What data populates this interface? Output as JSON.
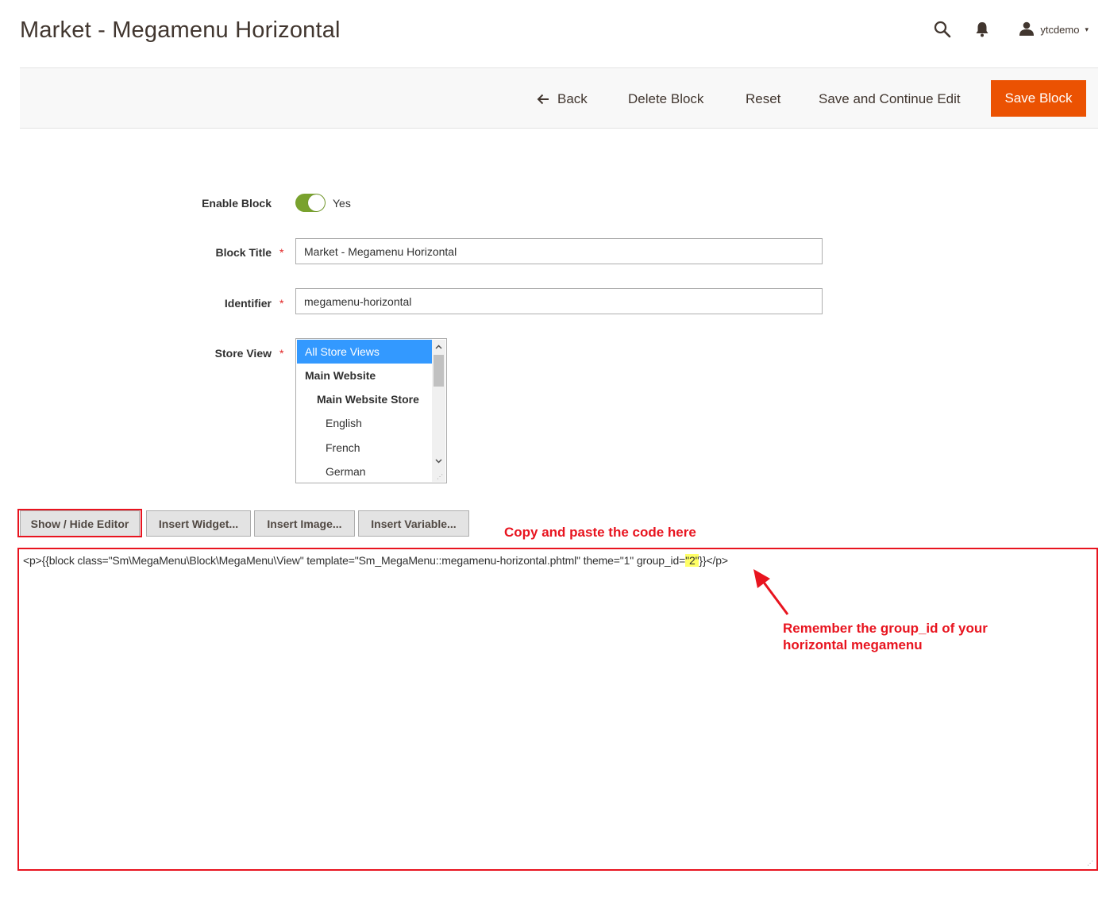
{
  "page": {
    "title": "Market - Megamenu Horizontal"
  },
  "header": {
    "search_icon": "search-icon",
    "bell_icon": "bell-icon",
    "user_icon": "user-icon",
    "username": "ytcdemo",
    "caret": "▾"
  },
  "actions": {
    "back": "Back",
    "delete": "Delete Block",
    "reset": "Reset",
    "save_continue": "Save and Continue Edit",
    "save": "Save Block"
  },
  "form": {
    "enable_label": "Enable Block",
    "enable_value": "Yes",
    "enable_on": true,
    "title_label": "Block Title",
    "title_value": "Market - Megamenu Horizontal",
    "identifier_label": "Identifier",
    "identifier_value": "megamenu-horizontal",
    "store_view_label": "Store View",
    "required_mark": "*",
    "store_options": [
      "All Store Views",
      "Main Website",
      "Main Website Store",
      "English",
      "French",
      "German"
    ],
    "store_selected": "All Store Views"
  },
  "editor": {
    "show_hide": "Show / Hide Editor",
    "insert_widget": "Insert Widget...",
    "insert_image": "Insert Image...",
    "insert_variable": "Insert Variable...",
    "content_before": "<p>{{block class=\"Sm\\MegaMenu\\Block\\MegaMenu\\View\" template=\"Sm_MegaMenu::megamenu-horizontal.phtml\" theme=\"1\" group_id=",
    "content_highlight": "\"2\"",
    "content_after": "}}</p>"
  },
  "annotations": {
    "copy_paste": "Copy and paste the code here",
    "remember_line1": "Remember the group_id of your",
    "remember_line2": "horizontal megamenu",
    "highlight_color": "#e8141f"
  },
  "colors": {
    "primary": "#eb5202",
    "toggle_on": "#79a22e",
    "select_highlight": "#3399ff"
  }
}
